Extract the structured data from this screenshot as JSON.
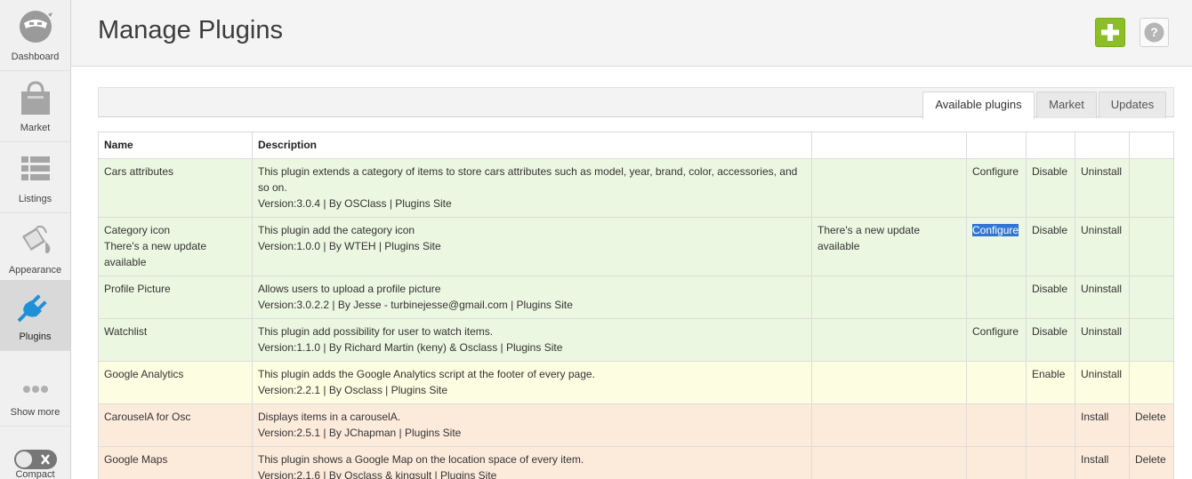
{
  "sidebar": {
    "items": [
      {
        "label": "Dashboard",
        "icon": "dashboard-icon"
      },
      {
        "label": "Market",
        "icon": "shopping-bag-icon"
      },
      {
        "label": "Listings",
        "icon": "list-icon"
      },
      {
        "label": "Appearance",
        "icon": "paint-bucket-icon"
      },
      {
        "label": "Plugins",
        "icon": "plug-icon",
        "active": true
      },
      {
        "label": "Show more",
        "icon": "dots-icon"
      },
      {
        "label": "Compact",
        "icon": "toggle-icon"
      }
    ]
  },
  "header": {
    "title": "Manage Plugins",
    "add_icon": "plus-icon",
    "help_icon": "help-icon"
  },
  "tabs": [
    {
      "label": "Available plugins",
      "active": true
    },
    {
      "label": "Market"
    },
    {
      "label": "Updates"
    }
  ],
  "table": {
    "headers": [
      "Name",
      "Description",
      "",
      "",
      "",
      "",
      ""
    ],
    "rows": [
      {
        "name": "Cars attributes",
        "name_note": "",
        "description": "This plugin extends a category of items to store cars attributes such as model, year, brand, color, accessories, and so on.",
        "meta": "Version:3.0.4 | By OSClass | Plugins Site",
        "update": "",
        "configure": "Configure",
        "toggle": "Disable",
        "install": "Uninstall",
        "delete": ""
      },
      {
        "name": "Category icon",
        "name_note": "There's a new update available",
        "description": "This plugin add the category icon",
        "meta": "Version:1.0.0 | By WTEH | Plugins Site",
        "update": "There's a new update available",
        "configure": "Configure",
        "toggle": "Disable",
        "install": "Uninstall",
        "delete": ""
      },
      {
        "name": "Profile Picture",
        "name_note": "",
        "description": "Allows users to upload a profile picture",
        "meta": "Version:3.0.2.2 | By Jesse - turbinejesse@gmail.com | Plugins Site",
        "update": "",
        "configure": "",
        "toggle": "Disable",
        "install": "Uninstall",
        "delete": ""
      },
      {
        "name": "Watchlist",
        "name_note": "",
        "description": "This plugin add possibility for user to watch items.",
        "meta": "Version:1.1.0 | By Richard Martin (keny) & Osclass | Plugins Site",
        "update": "",
        "configure": "Configure",
        "toggle": "Disable",
        "install": "Uninstall",
        "delete": ""
      },
      {
        "name": "Google Analytics",
        "name_note": "",
        "description": "This plugin adds the Google Analytics script at the footer of every page.",
        "meta": "Version:2.2.1 | By Osclass | Plugins Site",
        "update": "",
        "configure": "",
        "toggle": "Enable",
        "install": "Uninstall",
        "delete": ""
      },
      {
        "name": "CarouselA for Osc",
        "name_note": "",
        "description": "Displays items in a carouselA.",
        "meta": "Version:2.5.1 | By JChapman | Plugins Site",
        "update": "",
        "configure": "",
        "toggle": "",
        "install": "Install",
        "delete": "Delete"
      },
      {
        "name": "Google Maps",
        "name_note": "",
        "description": "This plugin shows a Google Map on the location space of every item.",
        "meta": "Version:2.1.6 | By Osclass & kingsult | Plugins Site",
        "update": "",
        "configure": "",
        "toggle": "",
        "install": "Install",
        "delete": "Delete"
      }
    ]
  },
  "colors": {
    "row_active": "#ecf7e1",
    "row_inactive": "#fdfde1",
    "row_not_installed": "#fcebdb",
    "add_button": "#8cbf26",
    "selection": "#3176d2"
  }
}
